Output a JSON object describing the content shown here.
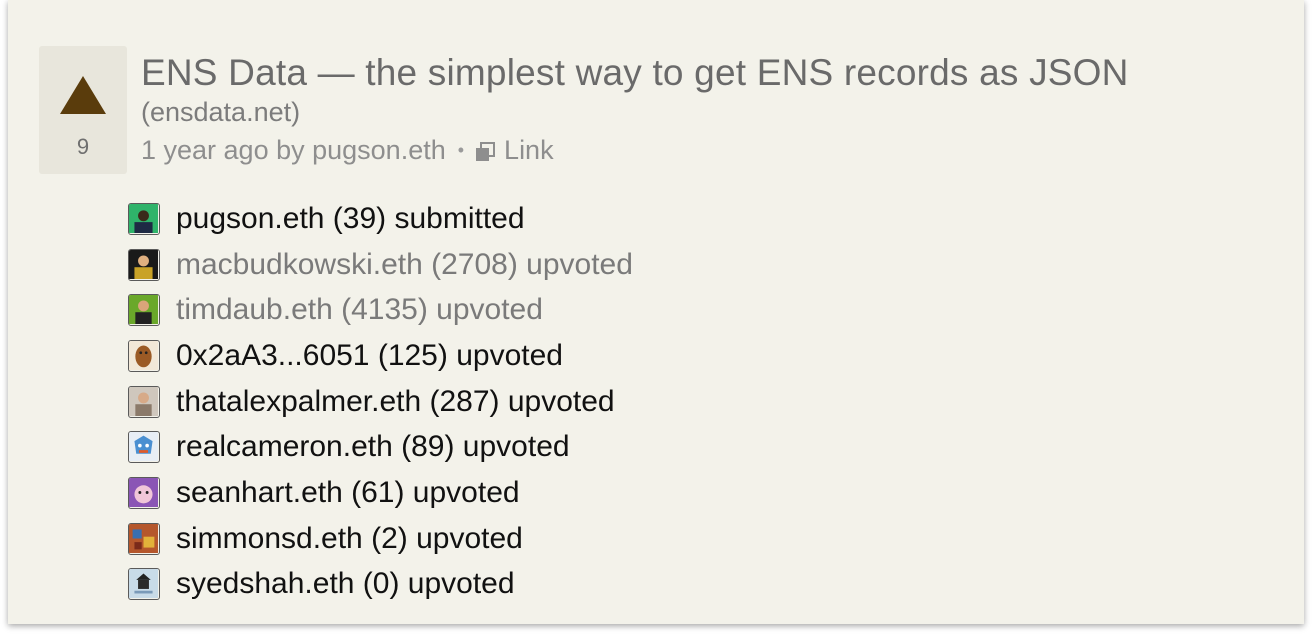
{
  "post": {
    "votes": "9",
    "title": "ENS Data — the simplest way to get ENS records as JSON",
    "domain": "(ensdata.net)",
    "meta_text": "1 year ago by pugson.eth",
    "separator": "•",
    "link_label": "Link",
    "link_icon": "link-icon"
  },
  "activity": [
    {
      "text": "pugson.eth (39) submitted",
      "muted": false,
      "avatar_color": "#2fb36a"
    },
    {
      "text": "macbudkowski.eth (2708) upvoted",
      "muted": true,
      "avatar_color": "#c9a227"
    },
    {
      "text": "timdaub.eth (4135) upvoted",
      "muted": true,
      "avatar_color": "#6aa82a"
    },
    {
      "text": "0x2aA3...6051 (125) upvoted",
      "muted": false,
      "avatar_color": "#9b5a25"
    },
    {
      "text": "thatalexpalmer.eth (287) upvoted",
      "muted": false,
      "avatar_color": "#8b7a6a"
    },
    {
      "text": "realcameron.eth (89) upvoted",
      "muted": false,
      "avatar_color": "#4a8fd1"
    },
    {
      "text": "seanhart.eth (61) upvoted",
      "muted": false,
      "avatar_color": "#8a55b5"
    },
    {
      "text": "simmonsd.eth (2) upvoted",
      "muted": false,
      "avatar_color": "#b5572c"
    },
    {
      "text": "syedshah.eth (0) upvoted",
      "muted": false,
      "avatar_color": "#c8dbe8"
    }
  ],
  "colors": {
    "background": "#f3f2ea",
    "vote_box": "#e8e6dc",
    "upvote_arrow": "#5a3c0c",
    "title": "#6a6a6a",
    "muted_text": "#7a7a7a"
  }
}
